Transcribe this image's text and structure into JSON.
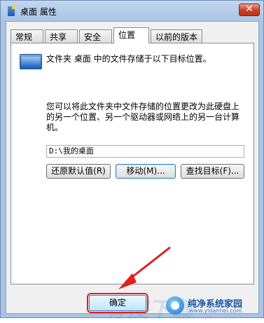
{
  "window": {
    "title": "桌面 属性",
    "close_label": "✕"
  },
  "tabs": [
    {
      "label": "常规"
    },
    {
      "label": "共享"
    },
    {
      "label": "安全"
    },
    {
      "label": "位置",
      "active": true
    },
    {
      "label": "以前的版本"
    }
  ],
  "location": {
    "description": "文件夹 桌面 中的文件存储于以下目标位置。",
    "instruction": "您可以将此文件夹中文件存储的位置更改为此硬盘上的另一个位置、另一个驱动器或网络上的另一台计算机。",
    "path_value": "D:\\我的桌面",
    "restore_label": "还原默认值(R)",
    "move_label": "移动(M)...",
    "find_label": "查找目标(F)..."
  },
  "footer": {
    "ok_label": "确定"
  },
  "watermark": {
    "text": "纯净系统家园",
    "url": "www.yidaimei.com",
    "overlay": "有搜下载"
  },
  "colors": {
    "annotation_red": "#e02020",
    "ok_accent": "#3c7fb1"
  }
}
